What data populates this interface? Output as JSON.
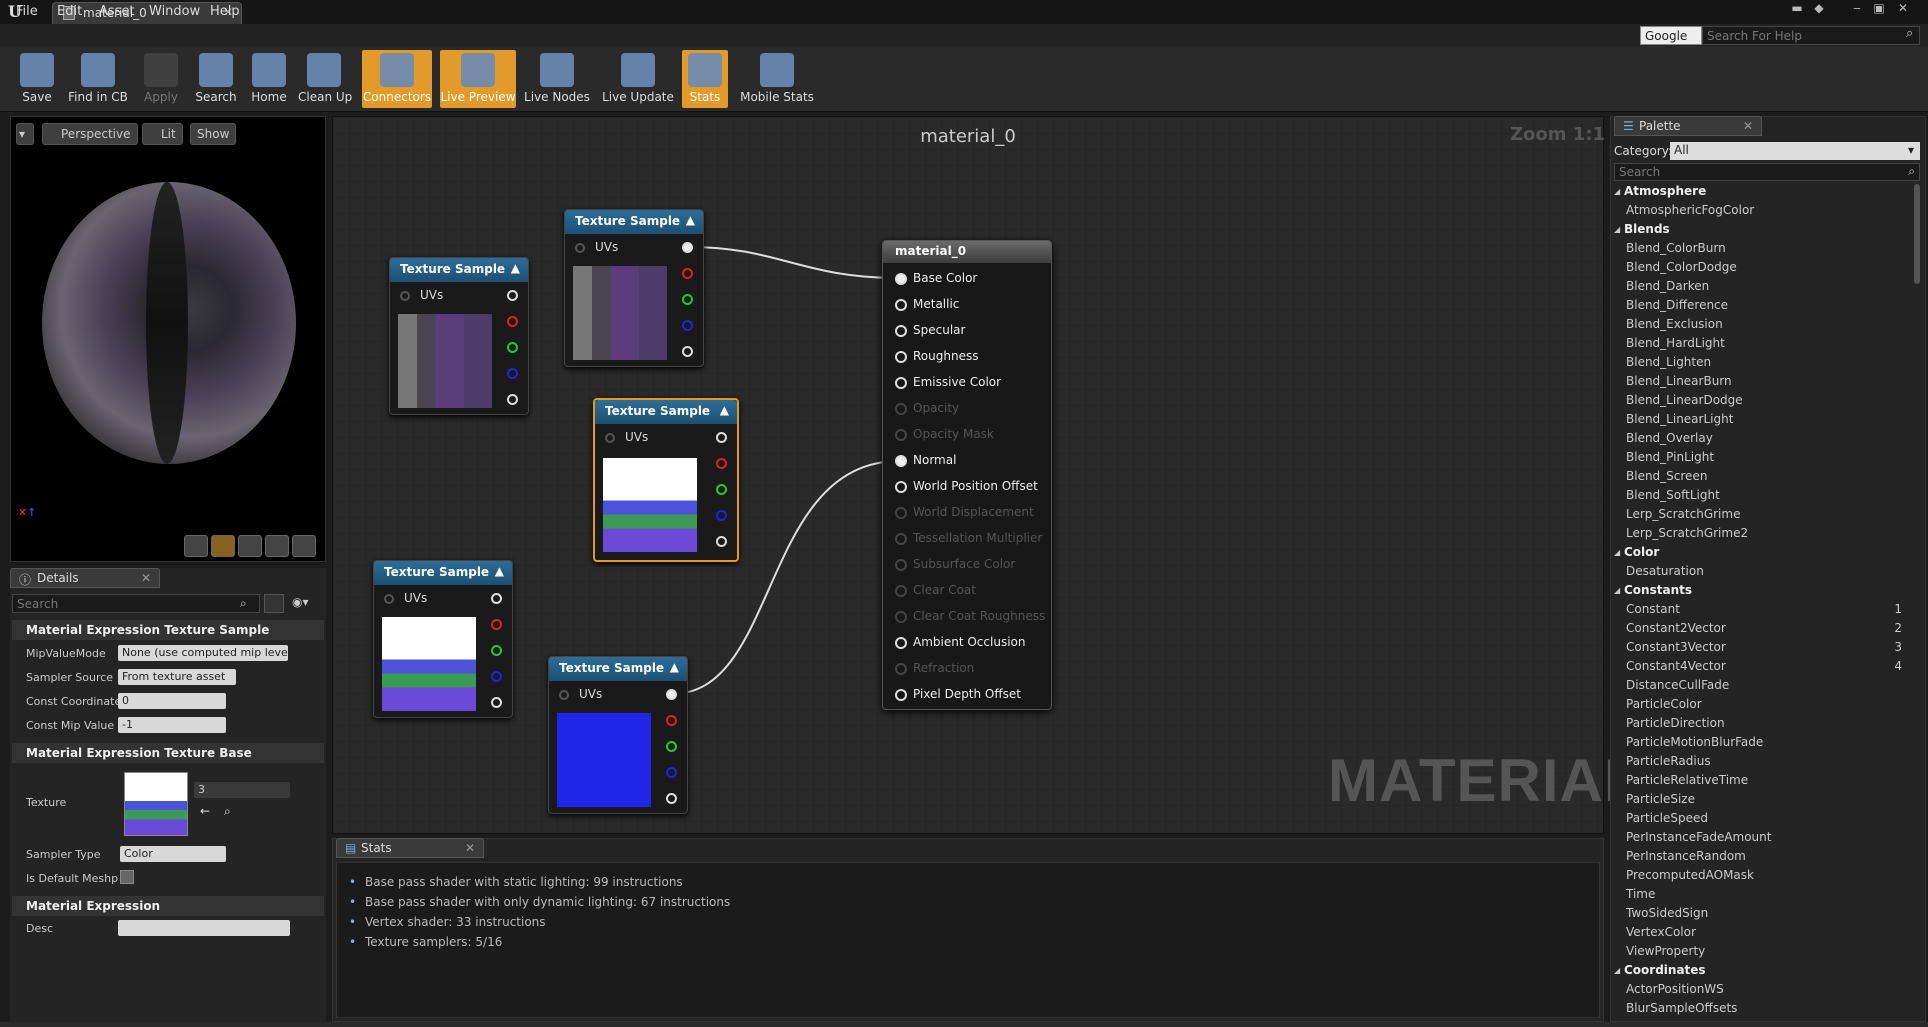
{
  "window": {
    "tab_title": "material_0"
  },
  "menu": [
    "File",
    "Edit",
    "Asset",
    "Window",
    "Help"
  ],
  "help": {
    "engine": "Google",
    "placeholder": "Search For Help"
  },
  "toolbar": [
    {
      "label": "Save",
      "icon": "save-icon",
      "state": "normal"
    },
    {
      "label": "Find in CB",
      "icon": "find-in-cb-icon",
      "state": "normal"
    },
    {
      "label": "Apply",
      "icon": "apply-icon",
      "state": "disabled"
    },
    {
      "label": "Search",
      "icon": "search-icon",
      "state": "normal"
    },
    {
      "label": "Home",
      "icon": "home-icon",
      "state": "normal"
    },
    {
      "label": "Clean Up",
      "icon": "clean-up-icon",
      "state": "normal"
    },
    {
      "label": "Connectors",
      "icon": "connectors-icon",
      "state": "active"
    },
    {
      "label": "Live Preview",
      "icon": "live-preview-icon",
      "state": "active"
    },
    {
      "label": "Live Nodes",
      "icon": "live-nodes-icon",
      "state": "normal"
    },
    {
      "label": "Live Update",
      "icon": "live-update-icon",
      "state": "normal"
    },
    {
      "label": "Stats",
      "icon": "stats-icon",
      "state": "active"
    },
    {
      "label": "Mobile Stats",
      "icon": "mobile-stats-icon",
      "state": "normal"
    }
  ],
  "viewport": {
    "perspective": "Perspective",
    "lit": "Lit",
    "show": "Show"
  },
  "details": {
    "tab": "Details",
    "search_placeholder": "Search",
    "section1": "Material Expression Texture Sample",
    "mip_label": "MipValueMode",
    "mip_value": "None (use computed mip level)",
    "sampler_source_label": "Sampler Source",
    "sampler_source_value": "From texture asset",
    "const_coord_label": "Const Coordinate",
    "const_coord_value": "0",
    "const_mip_label": "Const Mip Value",
    "const_mip_value": "-1",
    "section2": "Material Expression Texture Base",
    "texture_label": "Texture",
    "texture_value": "3",
    "sampler_type_label": "Sampler Type",
    "sampler_type_value": "Color",
    "default_meshpaint_label": "Is Default Meshp",
    "section3": "Material Expression",
    "desc_label": "Desc"
  },
  "graph": {
    "title": "material_0",
    "zoom": "Zoom 1:1",
    "watermark": "MATERIAL",
    "node_title": "Texture Sample",
    "uvs": "UVs",
    "material_node": "material_0",
    "inputs": [
      {
        "label": "Base Color",
        "enabled": true,
        "connected": true
      },
      {
        "label": "Metallic",
        "enabled": true,
        "connected": false
      },
      {
        "label": "Specular",
        "enabled": true,
        "connected": false
      },
      {
        "label": "Roughness",
        "enabled": true,
        "connected": false
      },
      {
        "label": "Emissive Color",
        "enabled": true,
        "connected": false
      },
      {
        "label": "Opacity",
        "enabled": false,
        "connected": false
      },
      {
        "label": "Opacity Mask",
        "enabled": false,
        "connected": false
      },
      {
        "label": "Normal",
        "enabled": true,
        "connected": true
      },
      {
        "label": "World Position Offset",
        "enabled": true,
        "connected": false
      },
      {
        "label": "World Displacement",
        "enabled": false,
        "connected": false
      },
      {
        "label": "Tessellation Multiplier",
        "enabled": false,
        "connected": false
      },
      {
        "label": "Subsurface Color",
        "enabled": false,
        "connected": false
      },
      {
        "label": "Clear Coat",
        "enabled": false,
        "connected": false
      },
      {
        "label": "Clear Coat Roughness",
        "enabled": false,
        "connected": false
      },
      {
        "label": "Ambient Occlusion",
        "enabled": true,
        "connected": false
      },
      {
        "label": "Refraction",
        "enabled": false,
        "connected": false
      },
      {
        "label": "Pixel Depth Offset",
        "enabled": true,
        "connected": false
      }
    ]
  },
  "stats": {
    "tab": "Stats",
    "lines": [
      "Base pass shader with static lighting: 99 instructions",
      "Base pass shader with only dynamic lighting: 67 instructions",
      "Vertex shader: 33 instructions",
      "Texture samplers: 5/16"
    ]
  },
  "palette": {
    "tab": "Palette",
    "category_label": "Category:",
    "category_value": "All",
    "search_placeholder": "Search",
    "rows": [
      {
        "text": "Atmosphere",
        "cat": true
      },
      {
        "text": "AtmosphericFogColor"
      },
      {
        "text": "Blends",
        "cat": true
      },
      {
        "text": "Blend_ColorBurn"
      },
      {
        "text": "Blend_ColorDodge"
      },
      {
        "text": "Blend_Darken"
      },
      {
        "text": "Blend_Difference"
      },
      {
        "text": "Blend_Exclusion"
      },
      {
        "text": "Blend_HardLight"
      },
      {
        "text": "Blend_Lighten"
      },
      {
        "text": "Blend_LinearBurn"
      },
      {
        "text": "Blend_LinearDodge"
      },
      {
        "text": "Blend_LinearLight"
      },
      {
        "text": "Blend_Overlay"
      },
      {
        "text": "Blend_PinLight"
      },
      {
        "text": "Blend_Screen"
      },
      {
        "text": "Blend_SoftLight"
      },
      {
        "text": "Lerp_ScratchGrime"
      },
      {
        "text": "Lerp_ScratchGrime2"
      },
      {
        "text": "Color",
        "cat": true
      },
      {
        "text": "Desaturation"
      },
      {
        "text": "Constants",
        "cat": true
      },
      {
        "text": "Constant",
        "key": "1"
      },
      {
        "text": "Constant2Vector",
        "key": "2"
      },
      {
        "text": "Constant3Vector",
        "key": "3"
      },
      {
        "text": "Constant4Vector",
        "key": "4"
      },
      {
        "text": "DistanceCullFade"
      },
      {
        "text": "ParticleColor"
      },
      {
        "text": "ParticleDirection"
      },
      {
        "text": "ParticleMotionBlurFade"
      },
      {
        "text": "ParticleRadius"
      },
      {
        "text": "ParticleRelativeTime"
      },
      {
        "text": "ParticleSize"
      },
      {
        "text": "ParticleSpeed"
      },
      {
        "text": "PerInstanceFadeAmount"
      },
      {
        "text": "PerInstanceRandom"
      },
      {
        "text": "PrecomputedAOMask"
      },
      {
        "text": "Time"
      },
      {
        "text": "TwoSidedSign"
      },
      {
        "text": "VertexColor"
      },
      {
        "text": "ViewProperty"
      },
      {
        "text": "Coordinates",
        "cat": true
      },
      {
        "text": "ActorPositionWS"
      },
      {
        "text": "BlurSampleOffsets"
      }
    ]
  }
}
